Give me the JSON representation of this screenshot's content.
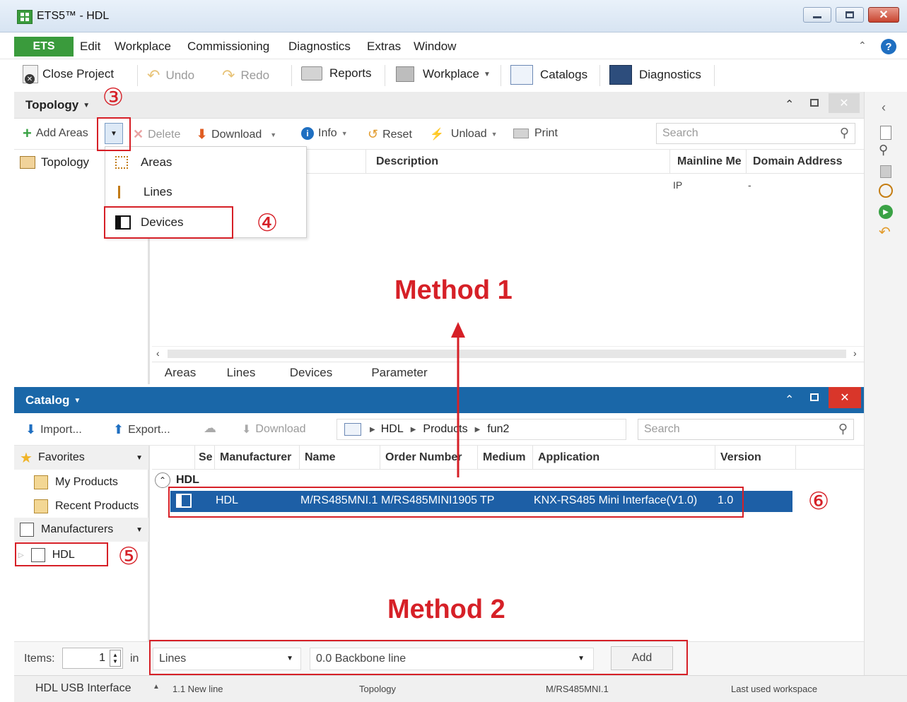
{
  "window": {
    "title": "ETS5™ - HDL"
  },
  "menubar": {
    "ets": "ETS",
    "items": [
      "Edit",
      "Workplace",
      "Commissioning",
      "Diagnostics",
      "Extras",
      "Window"
    ]
  },
  "toolbar": {
    "close_project": "Close Project",
    "undo": "Undo",
    "redo": "Redo",
    "reports": "Reports",
    "workplace": "Workplace",
    "catalogs": "Catalogs",
    "diagnostics": "Diagnostics"
  },
  "topology": {
    "title": "Topology",
    "add_areas": "Add Areas",
    "delete": "Delete",
    "download": "Download",
    "info": "Info",
    "reset": "Reset",
    "unload": "Unload",
    "print": "Print",
    "search_placeholder": "Search",
    "tree_root": "Topology",
    "columns": [
      "Description",
      "Mainline Me",
      "Domain Address"
    ],
    "row": {
      "medium": "IP",
      "domain": "-"
    },
    "dropdown": [
      "Areas",
      "Lines",
      "Devices"
    ],
    "tabs": [
      "Areas",
      "Lines",
      "Devices",
      "Parameter"
    ]
  },
  "catalog": {
    "title": "Catalog",
    "import": "Import...",
    "export": "Export...",
    "download": "Download",
    "breadcrumb": [
      "HDL",
      "Products",
      "fun2"
    ],
    "search_placeholder": "Search",
    "favorites": "Favorites",
    "my_products": "My Products",
    "recent_products": "Recent Products",
    "manufacturers": "Manufacturers",
    "hdl": "HDL",
    "columns": [
      "Se",
      "Manufacturer",
      "Name",
      "Order Number",
      "Medium",
      "Application",
      "Version"
    ],
    "group": "HDL",
    "product": {
      "manufacturer": "HDL",
      "name": "M/RS485MNI.1",
      "order_number": "M/RS485MINI1905",
      "medium": "TP",
      "application": "KNX-RS485 Mini Interface(V1.0)",
      "version": "1.0"
    }
  },
  "bottom": {
    "items_label": "Items:",
    "items_value": "1",
    "in_label": "in",
    "type_select": "Lines",
    "line_select": "0.0 Backbone line",
    "add": "Add"
  },
  "status": {
    "interface": "HDL USB Interface",
    "line": "1.1 New line",
    "view": "Topology",
    "device": "M/RS485MNI.1",
    "workspace": "Last used workspace"
  },
  "annotations": {
    "method1": "Method 1",
    "method2": "Method 2",
    "step3": "③",
    "step4": "④",
    "step5": "⑤",
    "step6": "⑥"
  },
  "colors": {
    "ets_green": "#3a9b3c",
    "catalog_blue": "#1a67a8",
    "annotation_red": "#d62027",
    "selection_blue": "#1d5fa6"
  }
}
